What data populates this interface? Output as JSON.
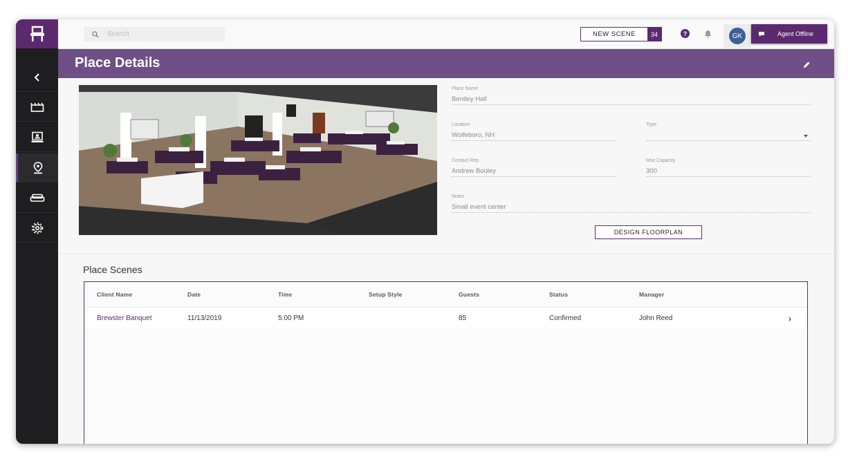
{
  "search": {
    "placeholder": "Search"
  },
  "topbar": {
    "new_scene_label": "NEW SCENE",
    "new_scene_count": "34",
    "help_glyph": "?",
    "avatar_initials": "GK",
    "agent_status": "Agent Offline"
  },
  "header": {
    "title": "Place Details"
  },
  "place": {
    "name_label": "Place Name",
    "name_value": "Bentley Hall",
    "location_label": "Location",
    "location_value": "Wolfeboro, NH",
    "type_label": "Type",
    "type_value": "",
    "contact_label": "Contact Rep",
    "contact_value": "Andrew Bouley",
    "capacity_label": "Max Capacity",
    "capacity_value": "300",
    "notes_label": "Notes",
    "notes_value": "Small event center",
    "design_button": "DESIGN FLOORPLAN"
  },
  "scenes": {
    "title": "Place Scenes",
    "columns": [
      "Client Name",
      "Date",
      "Time",
      "Setup Style",
      "Guests",
      "Status",
      "Manager"
    ],
    "rows": [
      {
        "client": "Brewster Banquet",
        "date": "11/13/2019",
        "time": "5:00 PM",
        "setup": "",
        "guests": "85",
        "status": "Confirmed",
        "manager": "John Reed"
      }
    ]
  },
  "colors": {
    "brand": "#5b2a6e",
    "header": "#6e4f86",
    "sidebar": "#1e1e20",
    "avatar": "#3f5f9a"
  },
  "icons": [
    "logo-chair-icon",
    "back-chevron-icon",
    "scenes-clapper-icon",
    "presentation-icon",
    "location-pin-icon",
    "sofa-icon",
    "gear-icon",
    "search-icon",
    "help-icon",
    "bell-icon",
    "chat-icon",
    "pencil-icon",
    "chevron-right-icon"
  ]
}
